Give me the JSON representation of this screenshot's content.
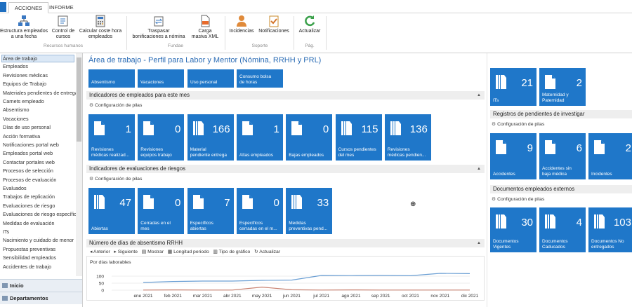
{
  "ribbon": {
    "tabs": [
      "ACCIONES",
      "INFORME"
    ],
    "buttons": {
      "estructura": "Estructura empleados\na una fecha",
      "control": "Control de\ncursos",
      "calcular": "Calcular coste hora\nempleados",
      "traspasar": "Traspasar\nbonificaciones a nómina",
      "carga": "Carga\nmasiva XML",
      "incidencias": "Incidencias",
      "notificaciones": "Notificaciones",
      "actualizar": "Actualizar"
    },
    "groups": {
      "recursos": "Recursos humanos",
      "fundae": "Fundae",
      "soporte": "Soporte",
      "pag": "Pág."
    }
  },
  "nav": {
    "items": [
      "Área de trabajo",
      "Empleados",
      "Revisiones médicas",
      "Equipos de Trabajo",
      "Materiales pendientes de entrega",
      "Carnets empleado",
      "Absentismo",
      "Vacaciones",
      "Días de uso personal",
      "Acción formativa",
      "Notificaciones portal web",
      "Empleados portal web",
      "Contactar portales web",
      "Procesos de selección",
      "Procesos de evaluación",
      "Evaluados",
      "Trabajos de replicación",
      "Evaluaciones de riesgo",
      "Evaluaciones de riesgo específicas",
      "Medidas de evaluación",
      "ITs",
      "Nacimiento y cuidado de menor",
      "Propuestas preventivas",
      "Sensibilidad empleados",
      "Accidentes de trabajo"
    ],
    "bottom": [
      "Inicio",
      "Departamentos"
    ]
  },
  "main": {
    "title": "Área de trabajo - Perfil para Labor y Mentor (Nómina, RRHH y PRL)",
    "quick_tiles": [
      "Absentismo",
      "Vacaciones",
      "Uso personal",
      "Consumo bolsa\nde horas"
    ],
    "sections": {
      "empleados": "Indicadores de empleados para este mes",
      "riesgos": "Indicadores de evaluaciones de riesgos",
      "absentismo": "Número de días de absentismo RRHH"
    },
    "config_label": "Configuración de pilas",
    "emp_tiles": [
      {
        "value": "1",
        "label": "Revisiones\nmédicas realizad..."
      },
      {
        "value": "0",
        "label": "Revisiones\nequipos trabajo"
      },
      {
        "value": "166",
        "label": "Material\npendiente entrega"
      },
      {
        "value": "1",
        "label": "Altas empleados"
      },
      {
        "value": "0",
        "label": "Bajas empleados"
      },
      {
        "value": "115",
        "label": "Cursos pendientes\ndel mes"
      },
      {
        "value": "136",
        "label": "Revisiones\nmédicas pendien..."
      }
    ],
    "risk_tiles": [
      {
        "value": "47",
        "label": "Abiertas"
      },
      {
        "value": "0",
        "label": "Cerradas en el\nmes"
      },
      {
        "value": "7",
        "label": "Específicos\nabiertas"
      },
      {
        "value": "0",
        "label": "Específicos\ncerradas en el m..."
      },
      {
        "value": "33",
        "label": "Medidas\npreventivas pend..."
      }
    ],
    "chart_toolbar": [
      "Anterior",
      "Siguiente",
      "Mostrar",
      "Longitud periodo",
      "Tipo de gráfico",
      "Actualizar"
    ]
  },
  "right": {
    "top_tiles": [
      {
        "value": "21",
        "label": "ITs"
      },
      {
        "value": "2",
        "label": "Maternidad y\nPaternidad"
      }
    ],
    "investigar_title": "Registros de pendientes de investigar",
    "investigar_tiles": [
      {
        "value": "9",
        "label": "Accidentes"
      },
      {
        "value": "6",
        "label": "Accidentes sin\nbaja médica"
      },
      {
        "value": "2",
        "label": "Incidentes"
      }
    ],
    "docs_title": "Documentos empleados externos",
    "docs_tiles": [
      {
        "value": "30",
        "label": "Documentos\nVigentes"
      },
      {
        "value": "4",
        "label": "Documentos\nCaducados"
      },
      {
        "value": "103",
        "label": "Documentos No\nentregados"
      }
    ]
  },
  "chart_data": {
    "type": "line",
    "ylabel": "Por días laborables",
    "ylim": [
      0,
      150
    ],
    "yticks": [
      "100",
      "50",
      "0"
    ],
    "categories": [
      "ene 2021",
      "feb 2021",
      "mar 2021",
      "abr 2021",
      "may 2021",
      "jun 2021",
      "jul 2021",
      "ago 2021",
      "sep 2021",
      "oct 2021",
      "nov 2021",
      "dic 2021"
    ],
    "series": [
      {
        "values": [
          55,
          62,
          65,
          65,
          70,
          72,
          105,
          104,
          105,
          103,
          120,
          118
        ],
        "color": "#6b9fd4"
      },
      {
        "values": [
          1,
          2,
          1,
          1,
          22,
          3,
          1,
          2,
          1,
          1,
          1,
          1
        ],
        "color": "#c98170"
      }
    ]
  }
}
